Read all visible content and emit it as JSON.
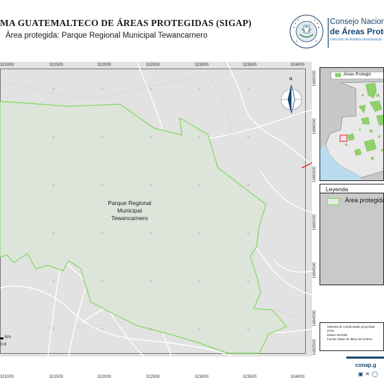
{
  "header": {
    "title": "MA GUATEMALTECO DE ÁREAS PROTEGIDAS (SIGAP)",
    "subtitle": "Área protegida: Parque Regional Municipal Tewancarnero",
    "seal_text_top": "GOBIERNO DE LA REPÚBLICA",
    "seal_text_bottom": "GUATEMALA",
    "brand_line1": "Consejo Nacional",
    "brand_line2": "de Áreas Protegi",
    "brand_line3": "Dirección de Análisis Geoespacial"
  },
  "map": {
    "x_ticks_top": [
      "321000",
      "321500",
      "322000",
      "322500",
      "323000",
      "323500",
      "324000"
    ],
    "x_ticks_bottom": [
      "321000",
      "321500",
      "322000",
      "322500",
      "323000",
      "323500",
      "324000"
    ],
    "y_ticks": [
      "1685000",
      "1686000",
      "1685500",
      "1685000",
      "1684500",
      "1684000",
      "1683500"
    ],
    "area_label": [
      "Parque Regional",
      "Municipal",
      "Tewancarnero"
    ],
    "north_label": "N",
    "scale_unit": "Km",
    "scale_value": "0.6",
    "colors": {
      "background": "#e3e3e3",
      "area_fill": "#dfe6dc",
      "area_stroke": "#7ed957",
      "roads": "#ffffff"
    }
  },
  "inset": {
    "legend_label": "Áreas Protegid"
  },
  "legend": {
    "title": "Leyenda",
    "item_label": "Área protegida"
  },
  "credits": [
    "Sistema de coordenadas proyectad",
    "GTM",
    "Datum WGS84",
    "Fuente: Base de datos de la Direc"
  ],
  "footer": {
    "url": "conap.g",
    "social_icons": [
      "facebook-icon",
      "x-icon",
      "instagram-icon"
    ]
  }
}
